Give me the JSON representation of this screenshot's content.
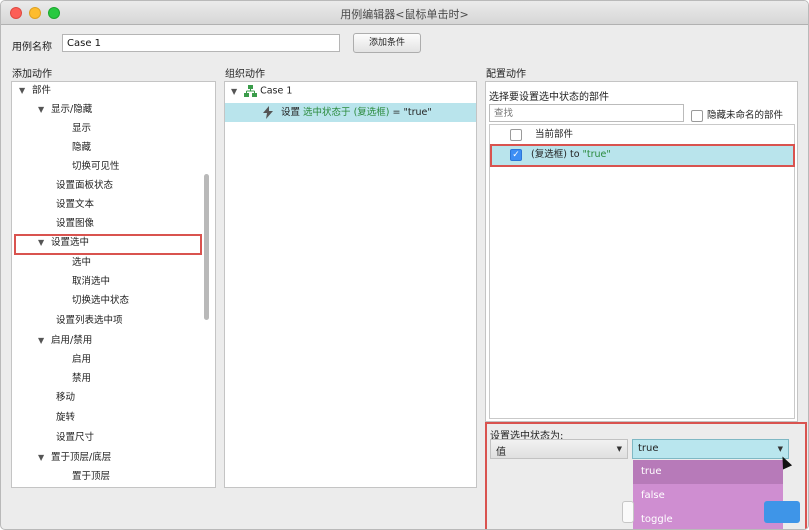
{
  "window": {
    "title": "用例编辑器<鼠标单击时>"
  },
  "case": {
    "label": "用例名称",
    "value": "Case 1",
    "add_condition": "添加条件"
  },
  "columns": {
    "add_action": "添加动作",
    "organize_action": "组织动作",
    "config_action": "配置动作"
  },
  "left_tree": [
    {
      "label": "部件",
      "level": 0,
      "expanded": true
    },
    {
      "label": "显示/隐藏",
      "level": 1,
      "expanded": true
    },
    {
      "label": "显示",
      "level": 2
    },
    {
      "label": "隐藏",
      "level": 2
    },
    {
      "label": "切换可见性",
      "level": 2
    },
    {
      "label": "设置面板状态",
      "level": 1
    },
    {
      "label": "设置文本",
      "level": 1
    },
    {
      "label": "设置图像",
      "level": 1
    },
    {
      "label": "设置选中",
      "level": 1,
      "expanded": true
    },
    {
      "label": "选中",
      "level": 2
    },
    {
      "label": "取消选中",
      "level": 2
    },
    {
      "label": "切换选中状态",
      "level": 2
    },
    {
      "label": "设置列表选中项",
      "level": 1
    },
    {
      "label": "启用/禁用",
      "level": 1,
      "expanded": true
    },
    {
      "label": "启用",
      "level": 2
    },
    {
      "label": "禁用",
      "level": 2
    },
    {
      "label": "移动",
      "level": 1
    },
    {
      "label": "旋转",
      "level": 1
    },
    {
      "label": "设置尺寸",
      "level": 1
    },
    {
      "label": "置于顶层/底层",
      "level": 1,
      "expanded": true
    },
    {
      "label": "置于顶层",
      "level": 2
    }
  ],
  "middle": {
    "case_name": "Case 1",
    "action_prefix": "设置",
    "action_green": "选中状态于 (复选框)",
    "action_value": "= \"true\""
  },
  "right": {
    "select_label": "选择要设置选中状态的部件",
    "search_placeholder": "查找",
    "hide_unnamed": "隐藏未命名的部件",
    "list": [
      {
        "label": "当前部件",
        "checked": false
      },
      {
        "label_prefix": "(复选框) to ",
        "label_value": "\"true\"",
        "checked": true
      }
    ],
    "state_label": "设置选中状态为:",
    "left_dropdown": "值",
    "right_dropdown": "true",
    "options": [
      "true",
      "false",
      "toggle"
    ]
  },
  "colors": {
    "highlight": "#b9e4ec",
    "red_outline": "#d9534f",
    "dropdown_menu": "#cf8ed1",
    "green_text": "#2a8a3c"
  }
}
